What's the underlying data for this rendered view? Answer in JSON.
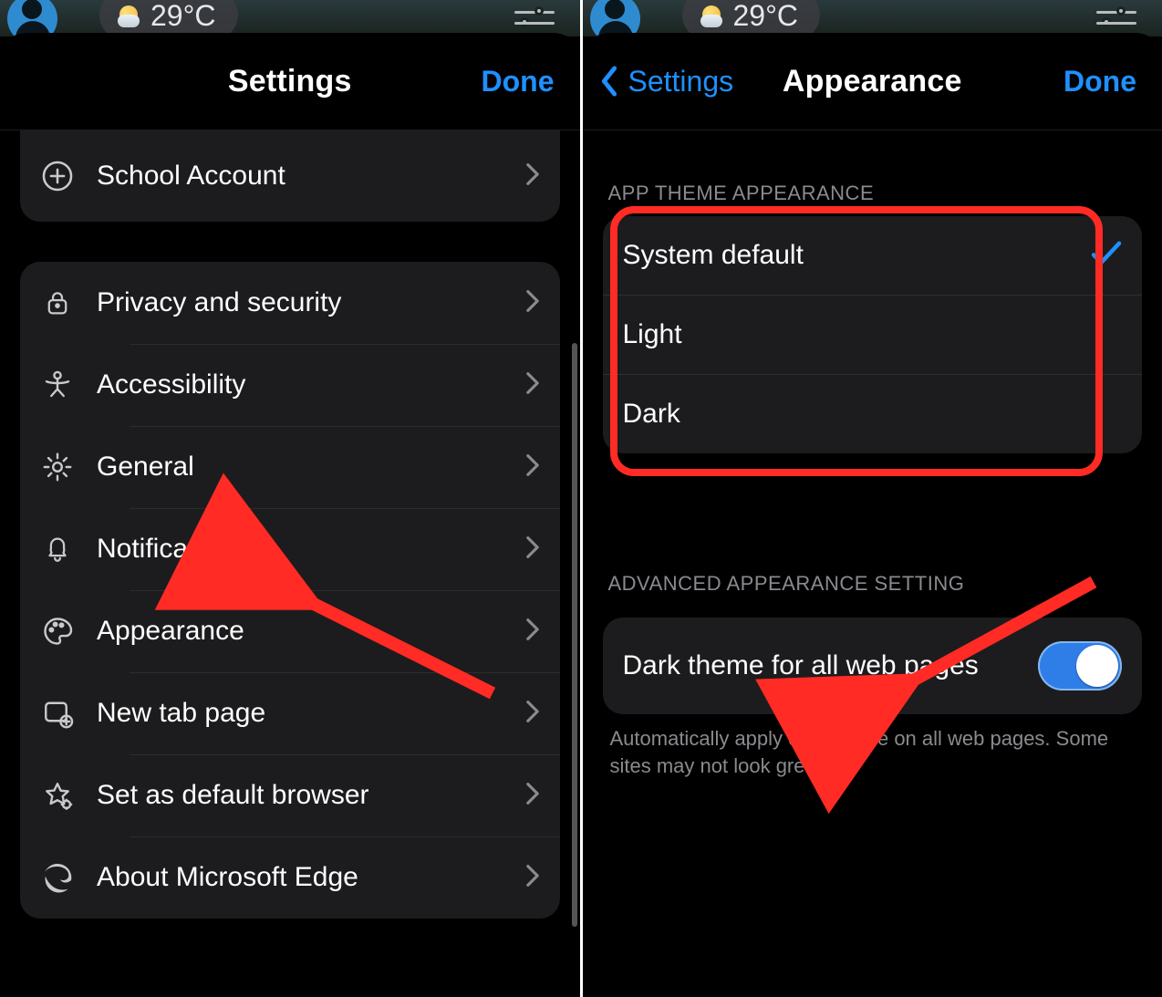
{
  "colors": {
    "accent": "#1e90ff",
    "highlight": "#ff2b24"
  },
  "topbar": {
    "temperature": "29°C"
  },
  "left": {
    "header": {
      "title": "Settings",
      "done": "Done"
    },
    "partial_item": {
      "label": "School Account",
      "icon": "plus-circle-icon"
    },
    "items": [
      {
        "icon": "lock-icon",
        "label": "Privacy and security"
      },
      {
        "icon": "person-icon",
        "label": "Accessibility"
      },
      {
        "icon": "gear-icon",
        "label": "General"
      },
      {
        "icon": "bell-icon",
        "label": "Notifications"
      },
      {
        "icon": "palette-icon",
        "label": "Appearance"
      },
      {
        "icon": "newtab-icon",
        "label": "New tab page"
      },
      {
        "icon": "star-gear-icon",
        "label": "Set as default browser"
      },
      {
        "icon": "edge-icon",
        "label": "About Microsoft Edge"
      }
    ]
  },
  "right": {
    "header": {
      "back": "Settings",
      "title": "Appearance",
      "done": "Done"
    },
    "section1_title": "APP THEME APPEARANCE",
    "theme_options": [
      {
        "label": "System default",
        "selected": true
      },
      {
        "label": "Light",
        "selected": false
      },
      {
        "label": "Dark",
        "selected": false
      }
    ],
    "section2_title": "ADVANCED APPEARANCE SETTING",
    "dark_all": {
      "label": "Dark theme for all web pages",
      "on": true
    },
    "footnote": "Automatically apply dark theme on all web pages. Some sites may not look great."
  }
}
